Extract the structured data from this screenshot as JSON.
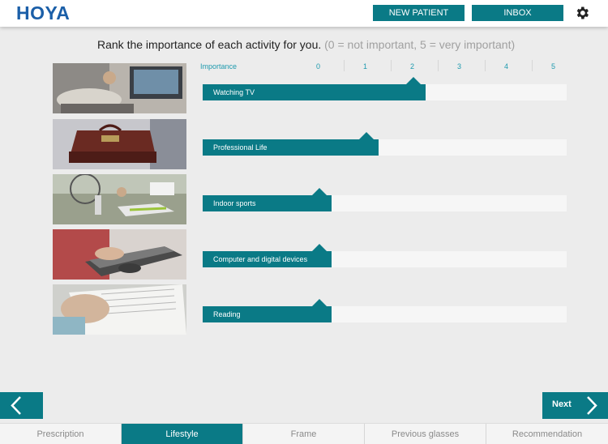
{
  "header": {
    "logo_text": "HOYA",
    "new_patient_label": "NEW PATIENT",
    "inbox_label": "INBOX",
    "settings_icon": "gear-icon"
  },
  "question": {
    "text": "Rank the importance of each activity for you.",
    "hint": "(0 = not important, 5 = very important)"
  },
  "scale": {
    "title": "Importance",
    "ticks": [
      "0",
      "1",
      "2",
      "3",
      "4",
      "5"
    ]
  },
  "activities": [
    {
      "label": "Watching TV",
      "value": 2,
      "image": "watching-tv-photo"
    },
    {
      "label": "Professional Life",
      "value": 1,
      "image": "briefcase-photo"
    },
    {
      "label": "Indoor sports",
      "value": 0,
      "image": "sport-shoes-photo"
    },
    {
      "label": "Computer and digital devices",
      "value": 0,
      "image": "laptop-photo"
    },
    {
      "label": "Reading",
      "value": 0,
      "image": "reading-photo"
    }
  ],
  "navigation": {
    "prev_icon": "chevron-left-icon",
    "next_label": "Next",
    "next_icon": "chevron-right-icon"
  },
  "tabs": [
    {
      "label": "Prescription",
      "active": false
    },
    {
      "label": "Lifestyle",
      "active": true
    },
    {
      "label": "Frame",
      "active": false
    },
    {
      "label": "Previous glasses",
      "active": false
    },
    {
      "label": "Recommendation",
      "active": false
    }
  ],
  "colors": {
    "accent": "#0a7a86",
    "scale_text": "#1e9aae",
    "logo": "#1b5fa8"
  }
}
